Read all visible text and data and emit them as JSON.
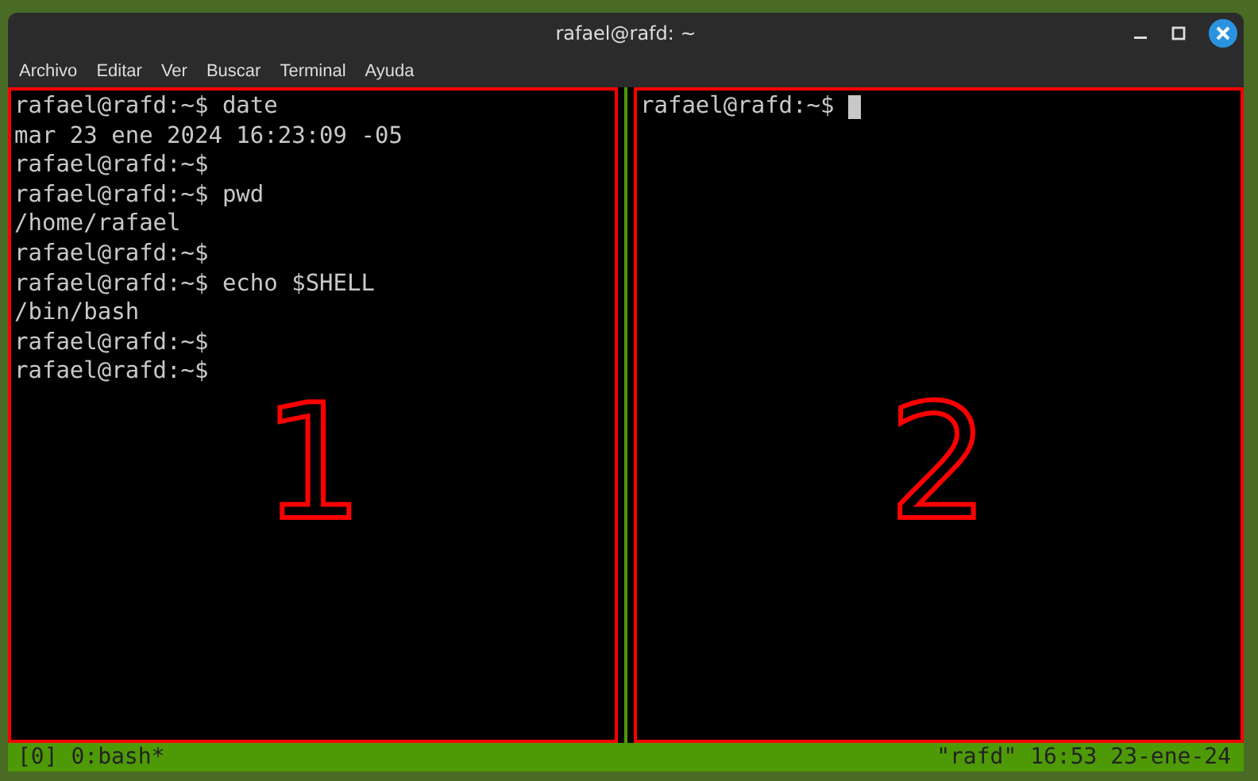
{
  "window": {
    "title": "rafael@rafd: ~"
  },
  "menu": [
    "Archivo",
    "Editar",
    "Ver",
    "Buscar",
    "Terminal",
    "Ayuda"
  ],
  "panes": [
    {
      "lines": [
        "rafael@rafd:~$ date",
        "mar 23 ene 2024 16:23:09 -05",
        "rafael@rafd:~$",
        "rafael@rafd:~$ pwd",
        "/home/rafael",
        "rafael@rafd:~$",
        "rafael@rafd:~$ echo $SHELL",
        "/bin/bash",
        "rafael@rafd:~$",
        "rafael@rafd:~$"
      ],
      "cursor": false,
      "annotation": "1"
    },
    {
      "lines": [
        "rafael@rafd:~$"
      ],
      "cursor": true,
      "annotation": "2"
    }
  ],
  "status_bar": {
    "left": "[0] 0:bash*",
    "right": "\"rafd\" 16:53 23-ene-24"
  }
}
